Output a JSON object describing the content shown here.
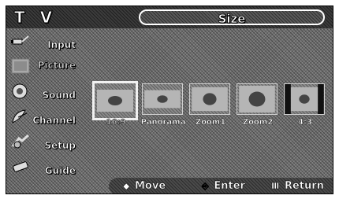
{
  "app": {
    "title": "T V"
  },
  "menu": {
    "title": "Size"
  },
  "sidebar": {
    "items": [
      {
        "label": "Input",
        "icon": "input-plug-icon"
      },
      {
        "label": "Picture",
        "icon": "picture-icon"
      },
      {
        "label": "Sound",
        "icon": "speaker-icon"
      },
      {
        "label": "Channel",
        "icon": "satellite-dish-icon"
      },
      {
        "label": "Setup",
        "icon": "setup-icon"
      },
      {
        "label": "Guide",
        "icon": "guide-remote-icon"
      }
    ],
    "active_index": 1
  },
  "options": {
    "items": [
      {
        "label": "16:9"
      },
      {
        "label": "Panorama"
      },
      {
        "label": "Zoom1"
      },
      {
        "label": "Zoom2"
      },
      {
        "label": "4:3"
      }
    ],
    "selected_index": 0
  },
  "footer": {
    "move_label": "Move",
    "enter_label": "Enter",
    "return_label": "Return",
    "move_icon": "◆",
    "enter_icon": "⎆",
    "return_icon": "Ⅲ"
  }
}
